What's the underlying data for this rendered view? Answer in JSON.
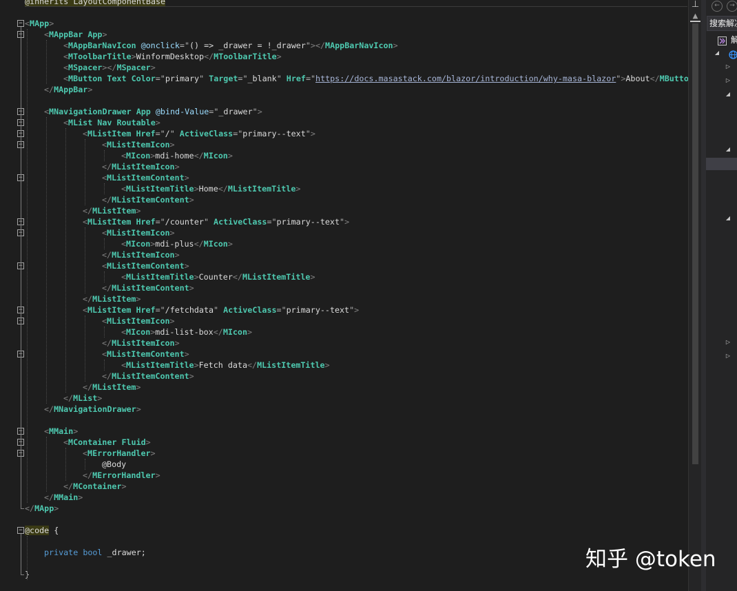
{
  "editor": {
    "top_line": "@inherits LayoutComponentBase",
    "lines": [
      [
        {
          "t": "<",
          "c": "delim"
        },
        {
          "t": "MApp",
          "c": "tag"
        },
        {
          "t": ">",
          "c": "delim"
        }
      ],
      [
        {
          "t": "<",
          "c": "delim"
        },
        {
          "t": "MAppBar",
          "c": "tag"
        },
        {
          "t": " ",
          "c": "plain"
        },
        {
          "t": "App",
          "c": "attr"
        },
        {
          "t": ">",
          "c": "delim"
        }
      ],
      [
        {
          "t": "<",
          "c": "delim"
        },
        {
          "t": "MAppBarNavIcon",
          "c": "tag"
        },
        {
          "t": " ",
          "c": "plain"
        },
        {
          "t": "@onclick",
          "c": "dir"
        },
        {
          "t": "=\"",
          "c": "punct"
        },
        {
          "t": "() => _drawer = !_drawer",
          "c": "str"
        },
        {
          "t": "\"",
          "c": "punct"
        },
        {
          "t": "></",
          "c": "delim"
        },
        {
          "t": "MAppBarNavIcon",
          "c": "tag"
        },
        {
          "t": ">",
          "c": "delim"
        }
      ],
      [
        {
          "t": "<",
          "c": "delim"
        },
        {
          "t": "MToolbarTitle",
          "c": "tag"
        },
        {
          "t": ">",
          "c": "delim"
        },
        {
          "t": "WinformDesktop",
          "c": "text"
        },
        {
          "t": "</",
          "c": "delim"
        },
        {
          "t": "MToolbarTitle",
          "c": "tag"
        },
        {
          "t": ">",
          "c": "delim"
        }
      ],
      [
        {
          "t": "<",
          "c": "delim"
        },
        {
          "t": "MSpacer",
          "c": "tag"
        },
        {
          "t": "></",
          "c": "delim"
        },
        {
          "t": "MSpacer",
          "c": "tag"
        },
        {
          "t": ">",
          "c": "delim"
        }
      ],
      [
        {
          "t": "<",
          "c": "delim"
        },
        {
          "t": "MButton",
          "c": "tag"
        },
        {
          "t": " ",
          "c": "plain"
        },
        {
          "t": "Text",
          "c": "attr"
        },
        {
          "t": " ",
          "c": "plain"
        },
        {
          "t": "Color",
          "c": "attr"
        },
        {
          "t": "=\"",
          "c": "punct"
        },
        {
          "t": "primary",
          "c": "str"
        },
        {
          "t": "\" ",
          "c": "punct"
        },
        {
          "t": "Target",
          "c": "attr"
        },
        {
          "t": "=\"",
          "c": "punct"
        },
        {
          "t": "_blank",
          "c": "str"
        },
        {
          "t": "\" ",
          "c": "punct"
        },
        {
          "t": "Href",
          "c": "attr"
        },
        {
          "t": "=\"",
          "c": "punct"
        },
        {
          "t": "https://docs.masastack.com/blazor/introduction/why-masa-blazor",
          "c": "url"
        },
        {
          "t": "\"",
          "c": "punct"
        },
        {
          "t": ">",
          "c": "delim"
        },
        {
          "t": "About",
          "c": "text"
        },
        {
          "t": "</",
          "c": "delim"
        },
        {
          "t": "MButton",
          "c": "tag"
        },
        {
          "t": ">",
          "c": "delim"
        }
      ],
      [
        {
          "t": "</",
          "c": "delim"
        },
        {
          "t": "MAppBar",
          "c": "tag"
        },
        {
          "t": ">",
          "c": "delim"
        }
      ],
      [],
      [
        {
          "t": "<",
          "c": "delim"
        },
        {
          "t": "MNavigationDrawer",
          "c": "tag"
        },
        {
          "t": " ",
          "c": "plain"
        },
        {
          "t": "App",
          "c": "attr"
        },
        {
          "t": " ",
          "c": "plain"
        },
        {
          "t": "@bind-Value",
          "c": "dir"
        },
        {
          "t": "=\"",
          "c": "punct"
        },
        {
          "t": "_drawer",
          "c": "str"
        },
        {
          "t": "\"",
          "c": "punct"
        },
        {
          "t": ">",
          "c": "delim"
        }
      ],
      [
        {
          "t": "<",
          "c": "delim"
        },
        {
          "t": "MList",
          "c": "tag"
        },
        {
          "t": " ",
          "c": "plain"
        },
        {
          "t": "Nav",
          "c": "attr"
        },
        {
          "t": " ",
          "c": "plain"
        },
        {
          "t": "Routable",
          "c": "attr"
        },
        {
          "t": ">",
          "c": "delim"
        }
      ],
      [
        {
          "t": "<",
          "c": "delim"
        },
        {
          "t": "MListItem",
          "c": "tag"
        },
        {
          "t": " ",
          "c": "plain"
        },
        {
          "t": "Href",
          "c": "attr"
        },
        {
          "t": "=\"",
          "c": "punct"
        },
        {
          "t": "/",
          "c": "str"
        },
        {
          "t": "\" ",
          "c": "punct"
        },
        {
          "t": "ActiveClass",
          "c": "attr"
        },
        {
          "t": "=\"",
          "c": "punct"
        },
        {
          "t": "primary--text",
          "c": "str"
        },
        {
          "t": "\"",
          "c": "punct"
        },
        {
          "t": ">",
          "c": "delim"
        }
      ],
      [
        {
          "t": "<",
          "c": "delim"
        },
        {
          "t": "MListItemIcon",
          "c": "tag"
        },
        {
          "t": ">",
          "c": "delim"
        }
      ],
      [
        {
          "t": "<",
          "c": "delim"
        },
        {
          "t": "MIcon",
          "c": "tag"
        },
        {
          "t": ">",
          "c": "delim"
        },
        {
          "t": "mdi-home",
          "c": "text"
        },
        {
          "t": "</",
          "c": "delim"
        },
        {
          "t": "MIcon",
          "c": "tag"
        },
        {
          "t": ">",
          "c": "delim"
        }
      ],
      [
        {
          "t": "</",
          "c": "delim"
        },
        {
          "t": "MListItemIcon",
          "c": "tag"
        },
        {
          "t": ">",
          "c": "delim"
        }
      ],
      [
        {
          "t": "<",
          "c": "delim"
        },
        {
          "t": "MListItemContent",
          "c": "tag"
        },
        {
          "t": ">",
          "c": "delim"
        }
      ],
      [
        {
          "t": "<",
          "c": "delim"
        },
        {
          "t": "MListItemTitle",
          "c": "tag"
        },
        {
          "t": ">",
          "c": "delim"
        },
        {
          "t": "Home",
          "c": "text"
        },
        {
          "t": "</",
          "c": "delim"
        },
        {
          "t": "MListItemTitle",
          "c": "tag"
        },
        {
          "t": ">",
          "c": "delim"
        }
      ],
      [
        {
          "t": "</",
          "c": "delim"
        },
        {
          "t": "MListItemContent",
          "c": "tag"
        },
        {
          "t": ">",
          "c": "delim"
        }
      ],
      [
        {
          "t": "</",
          "c": "delim"
        },
        {
          "t": "MListItem",
          "c": "tag"
        },
        {
          "t": ">",
          "c": "delim"
        }
      ],
      [
        {
          "t": "<",
          "c": "delim"
        },
        {
          "t": "MListItem",
          "c": "tag"
        },
        {
          "t": " ",
          "c": "plain"
        },
        {
          "t": "Href",
          "c": "attr"
        },
        {
          "t": "=\"",
          "c": "punct"
        },
        {
          "t": "/counter",
          "c": "str"
        },
        {
          "t": "\" ",
          "c": "punct"
        },
        {
          "t": "ActiveClass",
          "c": "attr"
        },
        {
          "t": "=\"",
          "c": "punct"
        },
        {
          "t": "primary--text",
          "c": "str"
        },
        {
          "t": "\"",
          "c": "punct"
        },
        {
          "t": ">",
          "c": "delim"
        }
      ],
      [
        {
          "t": "<",
          "c": "delim"
        },
        {
          "t": "MListItemIcon",
          "c": "tag"
        },
        {
          "t": ">",
          "c": "delim"
        }
      ],
      [
        {
          "t": "<",
          "c": "delim"
        },
        {
          "t": "MIcon",
          "c": "tag"
        },
        {
          "t": ">",
          "c": "delim"
        },
        {
          "t": "mdi-plus",
          "c": "text"
        },
        {
          "t": "</",
          "c": "delim"
        },
        {
          "t": "MIcon",
          "c": "tag"
        },
        {
          "t": ">",
          "c": "delim"
        }
      ],
      [
        {
          "t": "</",
          "c": "delim"
        },
        {
          "t": "MListItemIcon",
          "c": "tag"
        },
        {
          "t": ">",
          "c": "delim"
        }
      ],
      [
        {
          "t": "<",
          "c": "delim"
        },
        {
          "t": "MListItemContent",
          "c": "tag"
        },
        {
          "t": ">",
          "c": "delim"
        }
      ],
      [
        {
          "t": "<",
          "c": "delim"
        },
        {
          "t": "MListItemTitle",
          "c": "tag"
        },
        {
          "t": ">",
          "c": "delim"
        },
        {
          "t": "Counter",
          "c": "text"
        },
        {
          "t": "</",
          "c": "delim"
        },
        {
          "t": "MListItemTitle",
          "c": "tag"
        },
        {
          "t": ">",
          "c": "delim"
        }
      ],
      [
        {
          "t": "</",
          "c": "delim"
        },
        {
          "t": "MListItemContent",
          "c": "tag"
        },
        {
          "t": ">",
          "c": "delim"
        }
      ],
      [
        {
          "t": "</",
          "c": "delim"
        },
        {
          "t": "MListItem",
          "c": "tag"
        },
        {
          "t": ">",
          "c": "delim"
        }
      ],
      [
        {
          "t": "<",
          "c": "delim"
        },
        {
          "t": "MListItem",
          "c": "tag"
        },
        {
          "t": " ",
          "c": "plain"
        },
        {
          "t": "Href",
          "c": "attr"
        },
        {
          "t": "=\"",
          "c": "punct"
        },
        {
          "t": "/fetchdata",
          "c": "str"
        },
        {
          "t": "\" ",
          "c": "punct"
        },
        {
          "t": "ActiveClass",
          "c": "attr"
        },
        {
          "t": "=\"",
          "c": "punct"
        },
        {
          "t": "primary--text",
          "c": "str"
        },
        {
          "t": "\"",
          "c": "punct"
        },
        {
          "t": ">",
          "c": "delim"
        }
      ],
      [
        {
          "t": "<",
          "c": "delim"
        },
        {
          "t": "MListItemIcon",
          "c": "tag"
        },
        {
          "t": ">",
          "c": "delim"
        }
      ],
      [
        {
          "t": "<",
          "c": "delim"
        },
        {
          "t": "MIcon",
          "c": "tag"
        },
        {
          "t": ">",
          "c": "delim"
        },
        {
          "t": "mdi-list-box",
          "c": "text"
        },
        {
          "t": "</",
          "c": "delim"
        },
        {
          "t": "MIcon",
          "c": "tag"
        },
        {
          "t": ">",
          "c": "delim"
        }
      ],
      [
        {
          "t": "</",
          "c": "delim"
        },
        {
          "t": "MListItemIcon",
          "c": "tag"
        },
        {
          "t": ">",
          "c": "delim"
        }
      ],
      [
        {
          "t": "<",
          "c": "delim"
        },
        {
          "t": "MListItemContent",
          "c": "tag"
        },
        {
          "t": ">",
          "c": "delim"
        }
      ],
      [
        {
          "t": "<",
          "c": "delim"
        },
        {
          "t": "MListItemTitle",
          "c": "tag"
        },
        {
          "t": ">",
          "c": "delim"
        },
        {
          "t": "Fetch data",
          "c": "text"
        },
        {
          "t": "</",
          "c": "delim"
        },
        {
          "t": "MListItemTitle",
          "c": "tag"
        },
        {
          "t": ">",
          "c": "delim"
        }
      ],
      [
        {
          "t": "</",
          "c": "delim"
        },
        {
          "t": "MListItemContent",
          "c": "tag"
        },
        {
          "t": ">",
          "c": "delim"
        }
      ],
      [
        {
          "t": "</",
          "c": "delim"
        },
        {
          "t": "MListItem",
          "c": "tag"
        },
        {
          "t": ">",
          "c": "delim"
        }
      ],
      [
        {
          "t": "</",
          "c": "delim"
        },
        {
          "t": "MList",
          "c": "tag"
        },
        {
          "t": ">",
          "c": "delim"
        }
      ],
      [
        {
          "t": "</",
          "c": "delim"
        },
        {
          "t": "MNavigationDrawer",
          "c": "tag"
        },
        {
          "t": ">",
          "c": "delim"
        }
      ],
      [],
      [
        {
          "t": "<",
          "c": "delim"
        },
        {
          "t": "MMain",
          "c": "tag"
        },
        {
          "t": ">",
          "c": "delim"
        }
      ],
      [
        {
          "t": "<",
          "c": "delim"
        },
        {
          "t": "MContainer",
          "c": "tag"
        },
        {
          "t": " ",
          "c": "plain"
        },
        {
          "t": "Fluid",
          "c": "attr"
        },
        {
          "t": ">",
          "c": "delim"
        }
      ],
      [
        {
          "t": "<",
          "c": "delim"
        },
        {
          "t": "MErrorHandler",
          "c": "tag"
        },
        {
          "t": ">",
          "c": "delim"
        }
      ],
      [
        {
          "t": "@Body",
          "c": "text"
        }
      ],
      [
        {
          "t": "</",
          "c": "delim"
        },
        {
          "t": "MErrorHandler",
          "c": "tag"
        },
        {
          "t": ">",
          "c": "delim"
        }
      ],
      [
        {
          "t": "</",
          "c": "delim"
        },
        {
          "t": "MContainer",
          "c": "tag"
        },
        {
          "t": ">",
          "c": "delim"
        }
      ],
      [
        {
          "t": "</",
          "c": "delim"
        },
        {
          "t": "MMain",
          "c": "tag"
        },
        {
          "t": ">",
          "c": "delim"
        }
      ],
      [
        {
          "t": "</",
          "c": "delim"
        },
        {
          "t": "MApp",
          "c": "tag"
        },
        {
          "t": ">",
          "c": "delim"
        }
      ],
      [],
      [
        {
          "t": "@code",
          "c": "razor"
        },
        {
          "t": " {",
          "c": "plain"
        }
      ],
      [],
      [
        {
          "t": "private",
          "c": "kw"
        },
        {
          "t": " ",
          "c": "plain"
        },
        {
          "t": "bool",
          "c": "kw"
        },
        {
          "t": " _drawer;",
          "c": "plain"
        }
      ],
      [],
      [
        {
          "t": "}",
          "c": "plain"
        }
      ]
    ],
    "fold_toggle_symbol": "−"
  },
  "scrollbar": {
    "split_symbol": "⊥",
    "up_arrow": "▲"
  },
  "solution_explorer": {
    "search_label": "搜索解决",
    "back_symbol": "←",
    "forward_symbol": "→",
    "root_label": "解",
    "arrow_expanded": "◢",
    "arrow_collapsed": "▷",
    "solution_icon_color": "#b180d7",
    "web_icon_color": "#3794ff"
  },
  "watermark": {
    "text": "知乎 @token"
  }
}
